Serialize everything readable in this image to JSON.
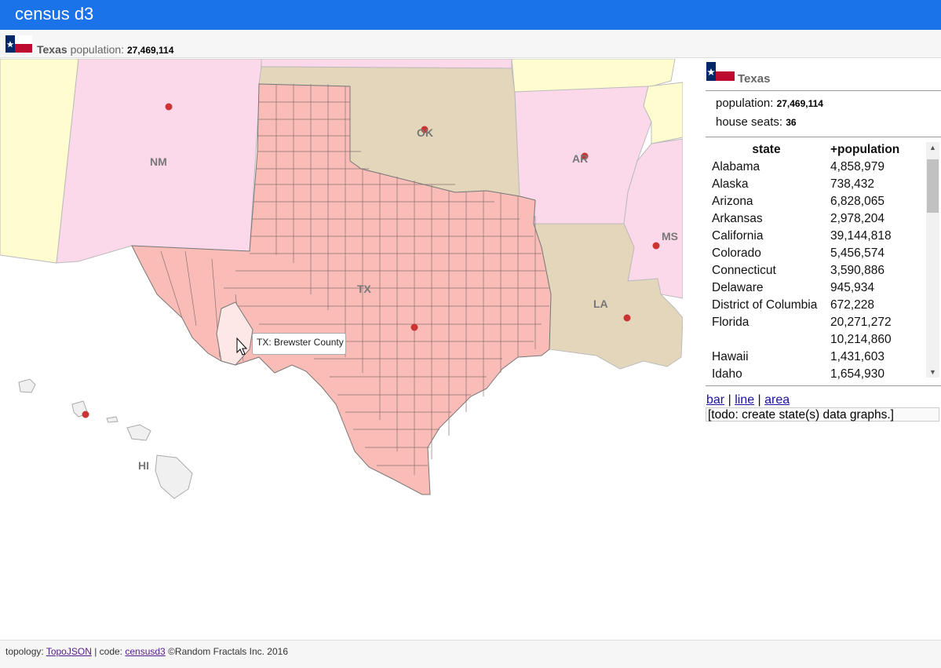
{
  "app": {
    "title": "census d3"
  },
  "infobar": {
    "state": "Texas",
    "population_label": "population:",
    "population": "27,469,114"
  },
  "map": {
    "labels": {
      "nm": "NM",
      "ok": "OK",
      "ar": "AR",
      "ms": "MS",
      "la": "LA",
      "tx": "TX",
      "hi": "HI"
    },
    "tooltip": "TX: Brewster County",
    "colors": {
      "selected": "#f9bcb6",
      "pink": "#fcd9ea",
      "tan": "#e4d6bb",
      "yellow": "#fffccf",
      "gray": "#f0f0f0",
      "dot": "#cc3333"
    }
  },
  "side": {
    "state": "Texas",
    "population_label": "population:",
    "population": "27,469,114",
    "seats_label": "house seats:",
    "seats": "36",
    "table": {
      "headers": [
        "state",
        "+population"
      ],
      "rows": [
        [
          "Alabama",
          "4,858,979"
        ],
        [
          "Alaska",
          "738,432"
        ],
        [
          "Arizona",
          "6,828,065"
        ],
        [
          "Arkansas",
          "2,978,204"
        ],
        [
          "California",
          "39,144,818"
        ],
        [
          "Colorado",
          "5,456,574"
        ],
        [
          "Connecticut",
          "3,590,886"
        ],
        [
          "Delaware",
          "945,934"
        ],
        [
          "District of Columbia",
          "672,228"
        ],
        [
          "Florida",
          "20,271,272"
        ],
        [
          "",
          "10,214,860"
        ],
        [
          "Hawaii",
          "1,431,603"
        ],
        [
          "Idaho",
          "1,654,930"
        ]
      ]
    },
    "links": {
      "bar": "bar",
      "line": "line",
      "area": "area",
      "sep": "|"
    },
    "todo": "[todo: create state(s) data graphs.]"
  },
  "footer": {
    "topology_label": "topology:",
    "topology_link": "TopoJSON",
    "code_label": "| code:",
    "code_link": "censusd3",
    "copyright": "©Random Fractals Inc. 2016"
  }
}
